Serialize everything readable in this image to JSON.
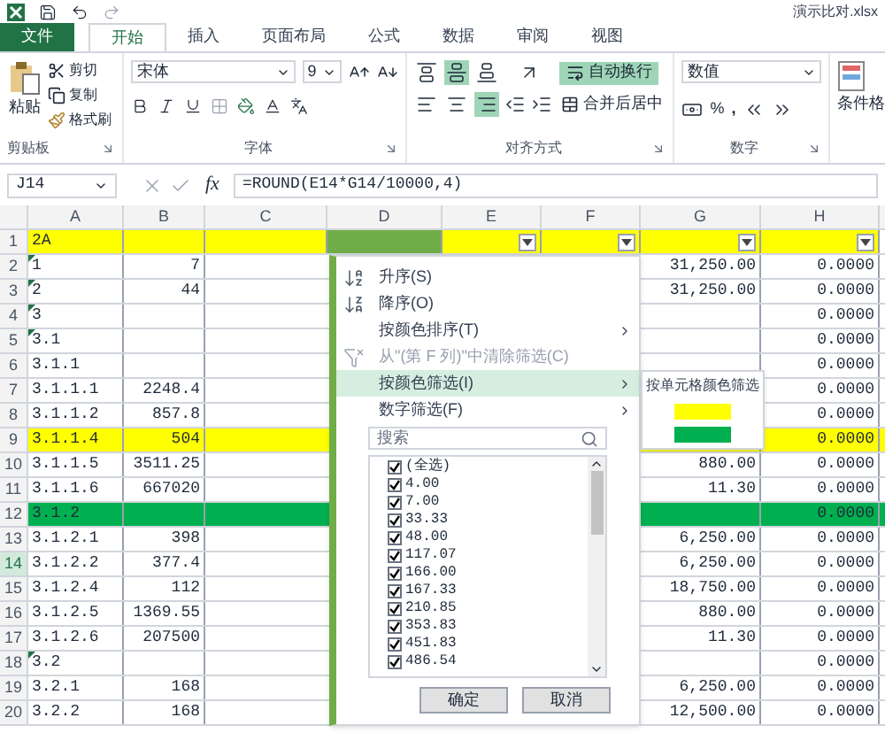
{
  "window": {
    "title": "演示比对.xlsx"
  },
  "tabs": [
    {
      "label": "文件",
      "kind": "file",
      "selected": false
    },
    {
      "label": "开始",
      "kind": "tab",
      "selected": true
    },
    {
      "label": "插入",
      "kind": "tab",
      "selected": false
    },
    {
      "label": "页面布局",
      "kind": "tab",
      "selected": false
    },
    {
      "label": "公式",
      "kind": "tab",
      "selected": false
    },
    {
      "label": "数据",
      "kind": "tab",
      "selected": false
    },
    {
      "label": "审阅",
      "kind": "tab",
      "selected": false
    },
    {
      "label": "视图",
      "kind": "tab",
      "selected": false
    }
  ],
  "ribbon": {
    "clipboard": {
      "paste": "粘贴",
      "cut": "剪切",
      "copy": "复制",
      "format_painter": "格式刷",
      "label": "剪贴板"
    },
    "font": {
      "name": "宋体",
      "size": "9",
      "label": "字体"
    },
    "alignment": {
      "wrap": {
        "label": "自动换行",
        "on": true
      },
      "merge": "合并后居中",
      "label": "对齐方式",
      "vertical": [
        {
          "selected": false
        },
        {
          "selected": true
        },
        {
          "selected": false
        }
      ],
      "horizontal": [
        {
          "selected": false
        },
        {
          "selected": false
        },
        {
          "selected": true
        }
      ]
    },
    "number": {
      "format": "数值",
      "percent": "%",
      "comma": ",",
      "label": "数字"
    },
    "styles": {
      "conditional": "条件格"
    }
  },
  "formula_bar": {
    "name_box": "J14",
    "fx": "fx",
    "formula": "=ROUND(E14*G14/10000,4)"
  },
  "columns": [
    "A",
    "B",
    "C",
    "D",
    "E",
    "F",
    "G",
    "H"
  ],
  "header_row": {
    "number": "1",
    "selected": false,
    "cells": [
      {
        "text": "2A",
        "color": "#ffff00",
        "filter": false
      },
      {
        "color": "#ffff00",
        "filter": false
      },
      {
        "color": "#ffff00",
        "filter": false
      },
      {
        "color": "#70ad47",
        "filter": false
      },
      {
        "color": "#ffff00",
        "filter": true
      },
      {
        "color": "#ffff00",
        "filter": true
      },
      {
        "color": "#ffff00",
        "filter": true
      },
      {
        "color": "#ffff00",
        "filter": true
      }
    ]
  },
  "rows": [
    {
      "number": "2",
      "selected": false,
      "flagged": true,
      "a": "1",
      "b": "7",
      "g": "31,250.00",
      "h": "0.0000"
    },
    {
      "number": "3",
      "selected": false,
      "flagged": true,
      "a": "2",
      "b": "44",
      "g": "31,250.00",
      "h": "0.0000"
    },
    {
      "number": "4",
      "selected": false,
      "flagged": true,
      "a": "3",
      "h": "0.0000"
    },
    {
      "number": "5",
      "selected": false,
      "flagged": true,
      "a": "3.1",
      "h": "0.0000"
    },
    {
      "number": "6",
      "selected": false,
      "flagged": false,
      "a": "3.1.1",
      "h": "0.0000"
    },
    {
      "number": "7",
      "selected": false,
      "flagged": false,
      "a": "3.1.1.1",
      "b": "2248.4",
      "h": "0.0000"
    },
    {
      "number": "8",
      "selected": false,
      "flagged": false,
      "a": "3.1.1.2",
      "b": "857.8",
      "h": "0.0000"
    },
    {
      "number": "9",
      "selected": false,
      "flagged": false,
      "color": "#ffff00",
      "a": "3.1.1.4",
      "b": "504",
      "h": "0.0000"
    },
    {
      "number": "10",
      "selected": false,
      "flagged": false,
      "a": "3.1.1.5",
      "b": "3511.25",
      "g": "880.00",
      "h": "0.0000"
    },
    {
      "number": "11",
      "selected": false,
      "flagged": false,
      "a": "3.1.1.6",
      "b": "667020",
      "g": "11.30",
      "h": "0.0000"
    },
    {
      "number": "12",
      "selected": false,
      "flagged": false,
      "color": "#00b050",
      "a": "3.1.2",
      "h": "0.0000"
    },
    {
      "number": "13",
      "selected": false,
      "flagged": false,
      "a": "3.1.2.1",
      "b": "398",
      "g": "6,250.00",
      "h": "0.0000"
    },
    {
      "number": "14",
      "selected": true,
      "flagged": false,
      "a": "3.1.2.2",
      "b": "377.4",
      "g": "6,250.00",
      "h": "0.0000"
    },
    {
      "number": "15",
      "selected": false,
      "flagged": false,
      "a": "3.1.2.4",
      "b": "112",
      "g": "18,750.00",
      "h": "0.0000"
    },
    {
      "number": "16",
      "selected": false,
      "flagged": false,
      "a": "3.1.2.5",
      "b": "1369.55",
      "g": "880.00",
      "h": "0.0000"
    },
    {
      "number": "17",
      "selected": false,
      "flagged": false,
      "a": "3.1.2.6",
      "b": "207500",
      "g": "11.30",
      "h": "0.0000"
    },
    {
      "number": "18",
      "selected": false,
      "flagged": true,
      "a": "3.2",
      "h": "0.0000"
    },
    {
      "number": "19",
      "selected": false,
      "flagged": false,
      "a": "3.2.1",
      "b": "168",
      "g": "6,250.00",
      "h": "0.0000"
    },
    {
      "number": "20",
      "selected": false,
      "flagged": false,
      "a": "3.2.2",
      "b": "168",
      "g": "12,500.00",
      "h": "0.0000"
    }
  ],
  "filter_menu": {
    "items": [
      {
        "label": "升序(S)",
        "kind": "sort_asc",
        "submenu": false,
        "disabled": false,
        "selected": false
      },
      {
        "label": "降序(O)",
        "kind": "sort_desc",
        "submenu": false,
        "disabled": false,
        "selected": false
      },
      {
        "label": "按颜色排序(T)",
        "kind": "plain",
        "submenu": true,
        "disabled": false,
        "selected": false
      },
      {
        "label": "从\"(第 F 列)\"中清除筛选(C)",
        "kind": "clear_filter",
        "submenu": false,
        "disabled": true,
        "selected": false
      },
      {
        "label": "按颜色筛选(I)",
        "kind": "plain",
        "submenu": true,
        "disabled": false,
        "selected": true
      },
      {
        "label": "数字筛选(F)",
        "kind": "plain",
        "submenu": true,
        "disabled": false,
        "selected": false
      }
    ],
    "search": {
      "placeholder": "搜索"
    },
    "values": [
      {
        "label": "(全选)",
        "checked": true
      },
      {
        "label": "4.00",
        "checked": true
      },
      {
        "label": "7.00",
        "checked": true
      },
      {
        "label": "33.33",
        "checked": true
      },
      {
        "label": "48.00",
        "checked": true
      },
      {
        "label": "117.07",
        "checked": true
      },
      {
        "label": "166.00",
        "checked": true
      },
      {
        "label": "167.33",
        "checked": true
      },
      {
        "label": "210.85",
        "checked": true
      },
      {
        "label": "353.83",
        "checked": true
      },
      {
        "label": "451.83",
        "checked": true
      },
      {
        "label": "486.54",
        "checked": true
      }
    ],
    "buttons": [
      "确定",
      "取消"
    ]
  },
  "color_submenu": {
    "title": "按单元格颜色筛选",
    "swatches": [
      {
        "color": "#ffff00"
      },
      {
        "color": "#00b050"
      }
    ]
  }
}
